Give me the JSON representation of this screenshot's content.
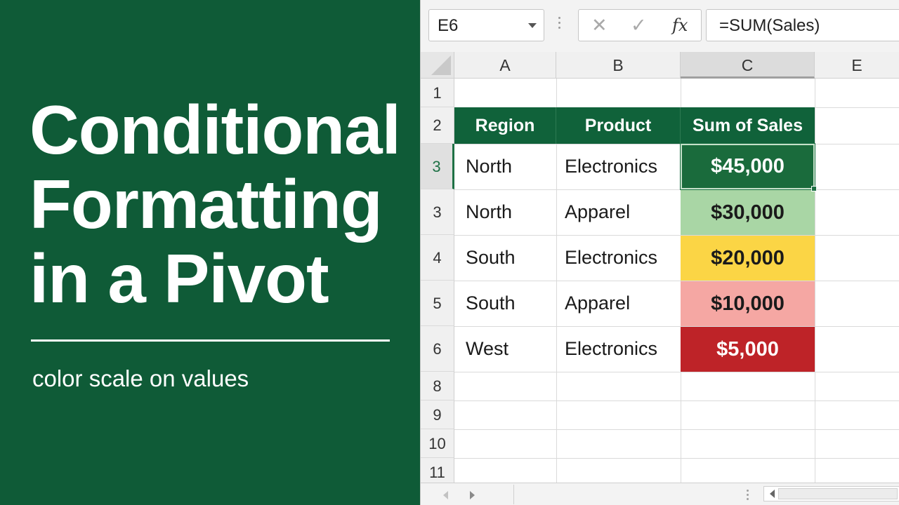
{
  "title_panel": {
    "title_lines": [
      "Conditional",
      "Formatting",
      "in a Pivot"
    ],
    "subtitle": "color scale on values",
    "background": "#0f5b37"
  },
  "formula_bar": {
    "name_box": "E6",
    "cancel_icon": "✕",
    "enter_icon": "✓",
    "function_icon": "fx",
    "formula": "=SUM(Sales)"
  },
  "columns": [
    "A",
    "B",
    "C",
    "E"
  ],
  "row_numbers": [
    "1",
    "2",
    "3",
    "3",
    "4",
    "5",
    "6",
    "8",
    "9",
    "10",
    "11"
  ],
  "pivot": {
    "headers": [
      "Region",
      "Product",
      "Sum of Sales"
    ],
    "rows": [
      {
        "region": "North",
        "product": "Electronics",
        "value": "$45,000",
        "fill": "#1a6b3c",
        "text_color": "#ffffff"
      },
      {
        "region": "North",
        "product": "Apparel",
        "value": "$30,000",
        "fill": "#a9d6a5",
        "text_color": "#1a1a1a"
      },
      {
        "region": "South",
        "product": "Electronics",
        "value": "$20,000",
        "fill": "#fbd545",
        "text_color": "#1a1a1a"
      },
      {
        "region": "South",
        "product": "Apparel",
        "value": "$10,000",
        "fill": "#f5a7a3",
        "text_color": "#1a1a1a"
      },
      {
        "region": "West",
        "product": "Electronics",
        "value": "$5,000",
        "fill": "#be2328",
        "text_color": "#ffffff"
      }
    ]
  },
  "accent_color": "#1e7145"
}
